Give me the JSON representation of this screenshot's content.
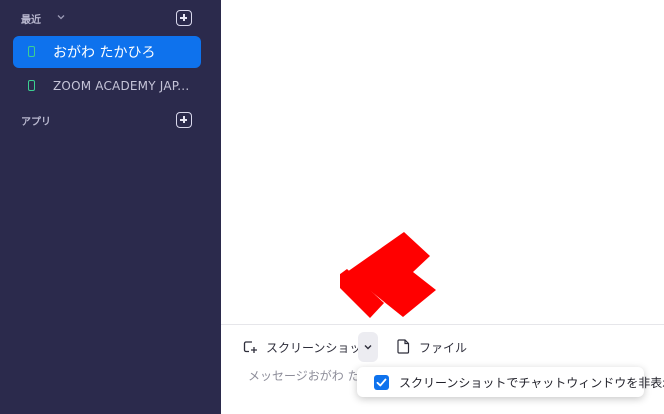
{
  "sidebar": {
    "recent_label": "最近",
    "apps_label": "アプリ",
    "chats": [
      {
        "name": "おがわ たかひろ",
        "active": true
      },
      {
        "name": "ZOOM ACADEMY JAP...",
        "active": false
      }
    ]
  },
  "toolbar": {
    "screenshot_label": "スクリーンショット",
    "file_label": "ファイル"
  },
  "composer": {
    "placeholder": "メッセージおがわ たか"
  },
  "popup": {
    "option_label": "スクリーンショットでチャットウィンドウを非表示",
    "checked": true
  },
  "colors": {
    "sidebar_bg": "#2b2a4c",
    "accent": "#0e72ed",
    "presence": "#3ccf91",
    "arrow": "#ff0000"
  }
}
